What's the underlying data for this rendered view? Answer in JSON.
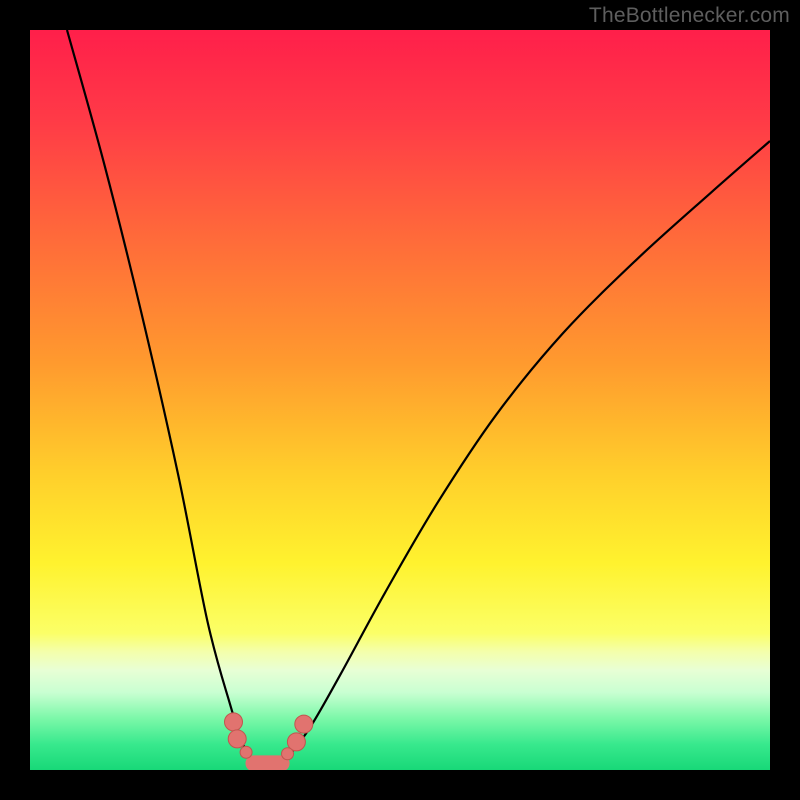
{
  "watermark": "TheBottlenecker.com",
  "chart_data": {
    "type": "line",
    "title": "",
    "xlabel": "",
    "ylabel": "",
    "xlim": [
      0,
      100
    ],
    "ylim": [
      0,
      100
    ],
    "notes": "Bottleneck curve. No axes or tick labels visible. Background is a vertical gradient from red (top, high bottleneck) through orange/yellow to green (bottom, low bottleneck). Curve minimum near x≈32 indicates the balanced point. Salmon-colored markers sit along the bottom of the valley.",
    "series": [
      {
        "name": "bottleneck-curve",
        "x": [
          5,
          10,
          15,
          20,
          24,
          27,
          29,
          31,
          33,
          35,
          38,
          42,
          48,
          55,
          63,
          72,
          82,
          92,
          100
        ],
        "y": [
          100,
          82,
          62,
          40,
          20,
          9,
          3,
          0.5,
          0.5,
          2,
          6,
          13,
          24,
          36,
          48,
          59,
          69,
          78,
          85
        ]
      }
    ],
    "markers": {
      "big": [
        [
          27.5,
          6.5
        ],
        [
          28.0,
          4.2
        ],
        [
          36.0,
          3.8
        ],
        [
          37.0,
          6.2
        ]
      ],
      "small": [
        [
          29.2,
          2.4
        ],
        [
          34.8,
          2.2
        ]
      ],
      "flat": [
        [
          30.2,
          0.9
        ],
        [
          34.0,
          0.9
        ]
      ]
    },
    "gradient_stops": [
      {
        "offset": 0.0,
        "color": "#ff1f4a"
      },
      {
        "offset": 0.12,
        "color": "#ff3a47"
      },
      {
        "offset": 0.28,
        "color": "#ff6a3a"
      },
      {
        "offset": 0.45,
        "color": "#ff9a2e"
      },
      {
        "offset": 0.6,
        "color": "#ffcf2b"
      },
      {
        "offset": 0.72,
        "color": "#fff22e"
      },
      {
        "offset": 0.815,
        "color": "#fbff67"
      },
      {
        "offset": 0.84,
        "color": "#f4ffab"
      },
      {
        "offset": 0.865,
        "color": "#e8ffd5"
      },
      {
        "offset": 0.895,
        "color": "#c9ffd2"
      },
      {
        "offset": 0.93,
        "color": "#7cf8a9"
      },
      {
        "offset": 0.965,
        "color": "#38e98d"
      },
      {
        "offset": 1.0,
        "color": "#18d878"
      }
    ]
  }
}
